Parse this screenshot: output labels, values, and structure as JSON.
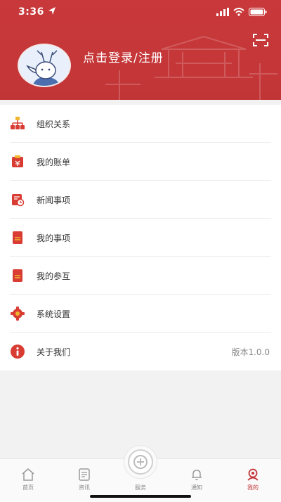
{
  "status_bar": {
    "time": "3:36"
  },
  "profile": {
    "login_text": "点击登录/注册"
  },
  "menu": [
    {
      "label": "组织关系",
      "icon": "org-chart-icon"
    },
    {
      "label": "我的账单",
      "icon": "bill-icon"
    },
    {
      "label": "新闻事项",
      "icon": "news-icon"
    },
    {
      "label": "我的事项",
      "icon": "document-icon"
    },
    {
      "label": "我的参互",
      "icon": "participation-icon"
    },
    {
      "label": "系统设置",
      "icon": "gear-icon"
    },
    {
      "label": "关于我们",
      "icon": "info-icon",
      "value": "版本1.0.0"
    }
  ],
  "tabbar": {
    "tabs": [
      {
        "label": "首页",
        "icon": "home-icon"
      },
      {
        "label": "资讯",
        "icon": "news-doc-icon"
      },
      {
        "label": "服务",
        "icon": "service-icon"
      },
      {
        "label": "通知",
        "icon": "bell-icon"
      },
      {
        "label": "我的",
        "icon": "profile-icon",
        "active": true
      }
    ]
  },
  "colors": {
    "brand_red": "#c23537",
    "icon_red": "#d83c33",
    "icon_gold": "#f0b52e"
  }
}
